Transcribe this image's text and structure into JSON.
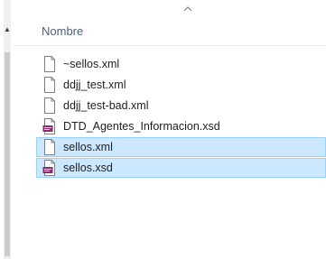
{
  "header": {
    "column_label": "Nombre"
  },
  "files": [
    {
      "name": "~sellos.xml",
      "icon": "blank-file-icon",
      "selected": false
    },
    {
      "name": "ddjj_test.xml",
      "icon": "blank-file-icon",
      "selected": false
    },
    {
      "name": "ddjj_test-bad.xml",
      "icon": "blank-file-icon",
      "selected": false
    },
    {
      "name": "DTD_Agentes_Informacion.xsd",
      "icon": "xsd-file-icon",
      "selected": false
    },
    {
      "name": "sellos.xml",
      "icon": "blank-file-icon",
      "selected": true
    },
    {
      "name": "sellos.xsd",
      "icon": "xsd-file-icon",
      "selected": true
    }
  ],
  "colors": {
    "selection_bg": "#cce8ff",
    "selection_border": "#99d1ff",
    "header_text": "#4c607a",
    "xsd_icon_badge": "#8a2c6e"
  }
}
